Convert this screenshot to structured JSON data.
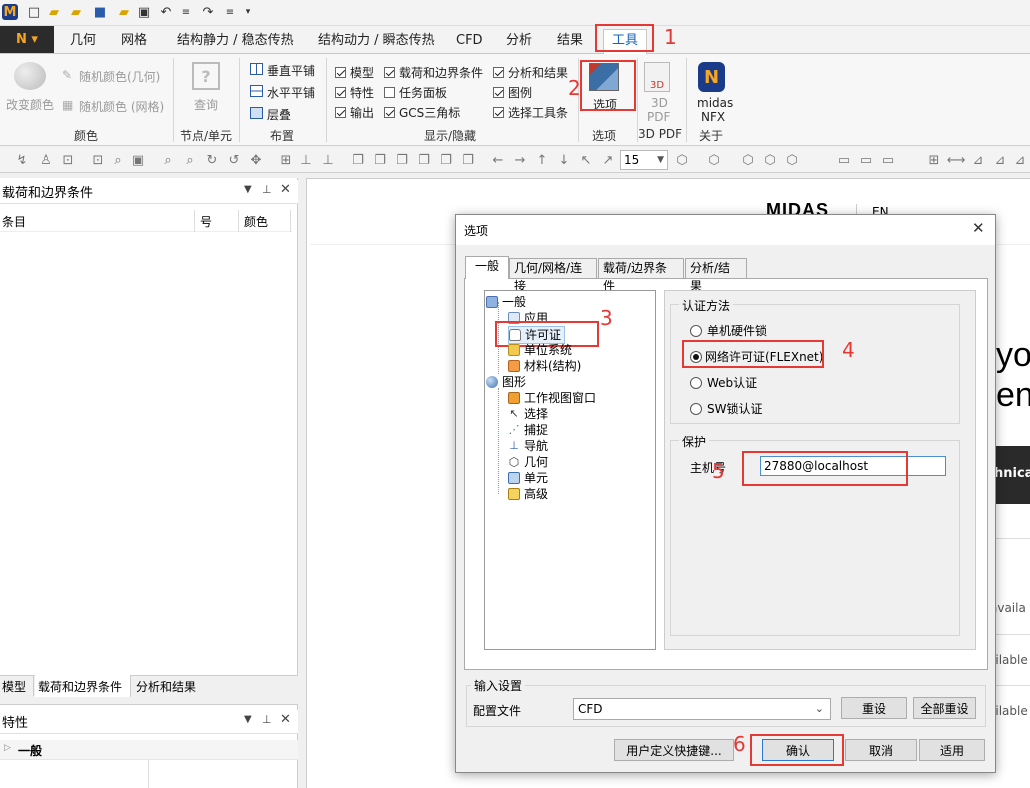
{
  "ribbon_tabs": [
    "几何",
    "网格",
    "结构静力 / 稳态传热",
    "结构动力 / 瞬态传热",
    "CFD",
    "分析",
    "结果",
    "工具"
  ],
  "ribbon": {
    "change_color": "改变颜色",
    "random_color_geom": "随机颜色(几何)",
    "random_color_mesh": "随机颜色 (网格)",
    "query": "查询",
    "tile_vertical": "垂直平铺",
    "tile_horizontal": "水平平铺",
    "cascade": "层叠",
    "chk_model": "模型",
    "chk_property": "特性",
    "chk_output": "输出",
    "chk_load_bc": "载荷和边界条件",
    "chk_task_panel": "任务面板",
    "chk_gcs": "GCS三角标",
    "chk_analysis_results": "分析和结果",
    "chk_legend": "图例",
    "chk_select_toolbar": "选择工具条",
    "options": "选项",
    "pdf3d_l1": "3D",
    "pdf3d_l2": "PDF",
    "midas_l1": "midas",
    "midas_l2": "NFX",
    "groups": {
      "color": "颜色",
      "node_element": "节点/单元",
      "layout": "布置",
      "show_hide": "显示/隐藏",
      "options": "选项",
      "pdf3d": "3D PDF",
      "about": "关于"
    }
  },
  "toolbar": {
    "zoom_value": "15"
  },
  "left_panel": {
    "title": "载荷和边界条件",
    "col_item": "条目",
    "col_no": "号",
    "col_color": "颜色",
    "bottom_tabs": [
      "模型",
      "载荷和边界条件",
      "分析和结果"
    ],
    "prop_title": "特性",
    "prop_general": "一般"
  },
  "canvas": {
    "logo": "MIDAS",
    "lang": "EN",
    "text_yo": "yo",
    "text_ens": "ens",
    "text_hnica": "hnica",
    "avail1": "availa",
    "avail2": "ailable",
    "avail3": "ailable"
  },
  "dialog": {
    "title": "选项",
    "tabs": [
      "一般",
      "几何/网格/连接",
      "载荷/边界条件",
      "分析/结果"
    ],
    "tree": {
      "general": "一般",
      "app": "应用",
      "license": "许可证",
      "unit_system": "单位系统",
      "material": "材料(结构)",
      "graphics": "图形",
      "viewport": "工作视图窗口",
      "select": "选择",
      "snap": "捕捉",
      "navigate": "导航",
      "geometry": "几何",
      "element": "单元",
      "advanced": "高级"
    },
    "auth_group": "认证方法",
    "auth_options": [
      "单机硬件锁",
      "网络许可证(FLEXnet)",
      "Web认证",
      "SW锁认证"
    ],
    "auth_selected": 1,
    "protect_group": "保护",
    "host_label": "主机号",
    "host_value": "27880@localhost",
    "input_settings": "输入设置",
    "config_label": "配置文件",
    "config_value": "CFD",
    "reset": "重设",
    "reset_all": "全部重设",
    "custom_shortcut": "用户定义快捷键...",
    "ok": "确认",
    "cancel": "取消",
    "apply": "适用"
  },
  "annotations": [
    "1",
    "2",
    "3",
    "4",
    "5",
    "6"
  ]
}
